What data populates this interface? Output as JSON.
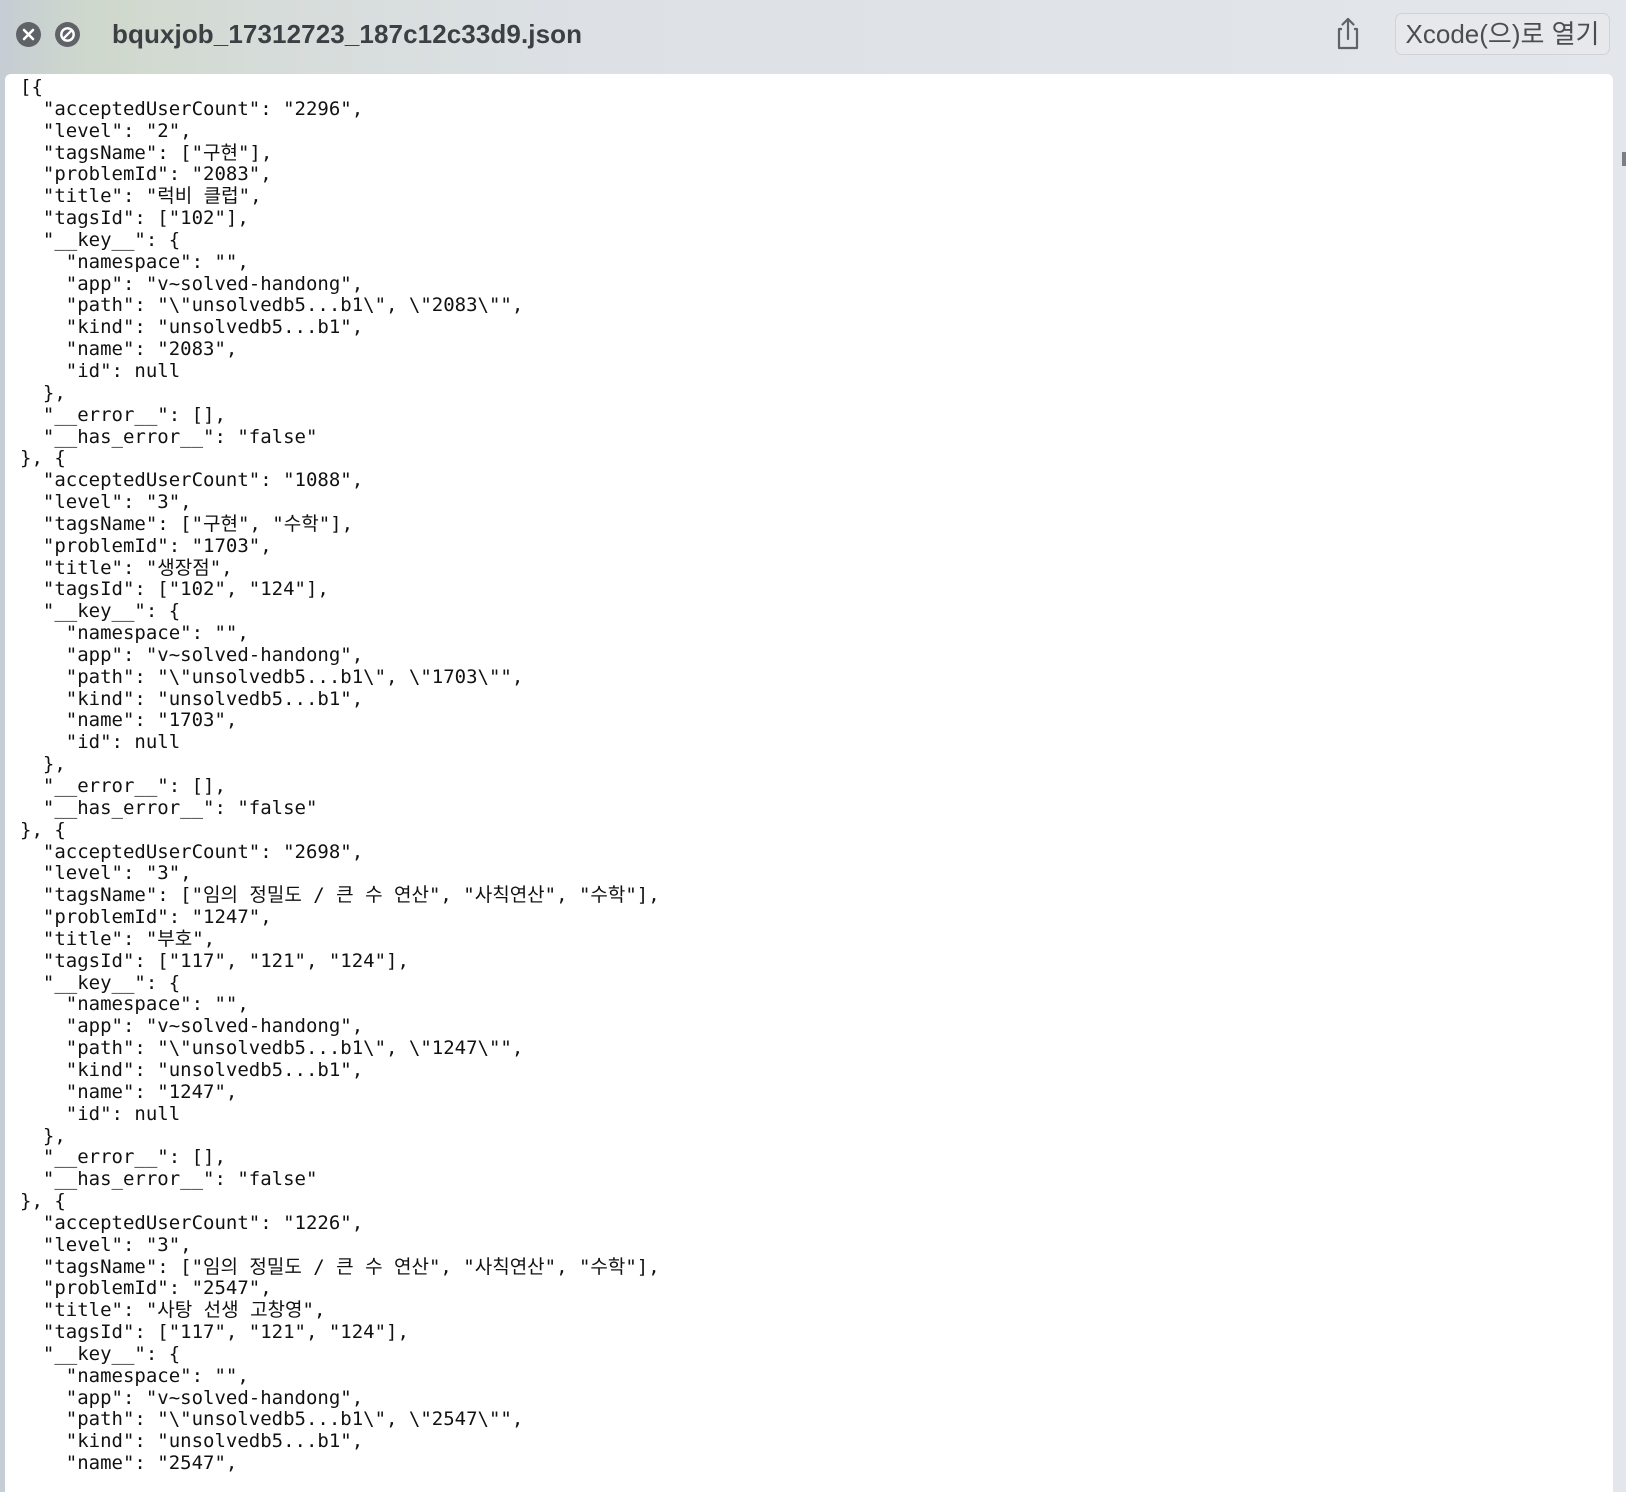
{
  "window": {
    "title": "bquxjob_17312723_187c12c33d9.json",
    "open_with_label": "Xcode(으)로 열기",
    "icons": {
      "close": "close-circle-icon",
      "stop": "no-entry-icon",
      "share": "share-icon"
    }
  },
  "file_lines": [
    "[{",
    "  \"acceptedUserCount\": \"2296\",",
    "  \"level\": \"2\",",
    "  \"tagsName\": [\"구현\"],",
    "  \"problemId\": \"2083\",",
    "  \"title\": \"럭비 클럽\",",
    "  \"tagsId\": [\"102\"],",
    "  \"__key__\": {",
    "    \"namespace\": \"\",",
    "    \"app\": \"v~solved-handong\",",
    "    \"path\": \"\\\"unsolvedb5...b1\\\", \\\"2083\\\"\",",
    "    \"kind\": \"unsolvedb5...b1\",",
    "    \"name\": \"2083\",",
    "    \"id\": null",
    "  },",
    "  \"__error__\": [],",
    "  \"__has_error__\": \"false\"",
    "}, {",
    "  \"acceptedUserCount\": \"1088\",",
    "  \"level\": \"3\",",
    "  \"tagsName\": [\"구현\", \"수학\"],",
    "  \"problemId\": \"1703\",",
    "  \"title\": \"생장점\",",
    "  \"tagsId\": [\"102\", \"124\"],",
    "  \"__key__\": {",
    "    \"namespace\": \"\",",
    "    \"app\": \"v~solved-handong\",",
    "    \"path\": \"\\\"unsolvedb5...b1\\\", \\\"1703\\\"\",",
    "    \"kind\": \"unsolvedb5...b1\",",
    "    \"name\": \"1703\",",
    "    \"id\": null",
    "  },",
    "  \"__error__\": [],",
    "  \"__has_error__\": \"false\"",
    "}, {",
    "  \"acceptedUserCount\": \"2698\",",
    "  \"level\": \"3\",",
    "  \"tagsName\": [\"임의 정밀도 / 큰 수 연산\", \"사칙연산\", \"수학\"],",
    "  \"problemId\": \"1247\",",
    "  \"title\": \"부호\",",
    "  \"tagsId\": [\"117\", \"121\", \"124\"],",
    "  \"__key__\": {",
    "    \"namespace\": \"\",",
    "    \"app\": \"v~solved-handong\",",
    "    \"path\": \"\\\"unsolvedb5...b1\\\", \\\"1247\\\"\",",
    "    \"kind\": \"unsolvedb5...b1\",",
    "    \"name\": \"1247\",",
    "    \"id\": null",
    "  },",
    "  \"__error__\": [],",
    "  \"__has_error__\": \"false\"",
    "}, {",
    "  \"acceptedUserCount\": \"1226\",",
    "  \"level\": \"3\",",
    "  \"tagsName\": [\"임의 정밀도 / 큰 수 연산\", \"사칙연산\", \"수학\"],",
    "  \"problemId\": \"2547\",",
    "  \"title\": \"사탕 선생 고창영\",",
    "  \"tagsId\": [\"117\", \"121\", \"124\"],",
    "  \"__key__\": {",
    "    \"namespace\": \"\",",
    "    \"app\": \"v~solved-handong\",",
    "    \"path\": \"\\\"unsolvedb5...b1\\\", \\\"2547\\\"\",",
    "    \"kind\": \"unsolvedb5...b1\",",
    "    \"name\": \"2547\","
  ]
}
